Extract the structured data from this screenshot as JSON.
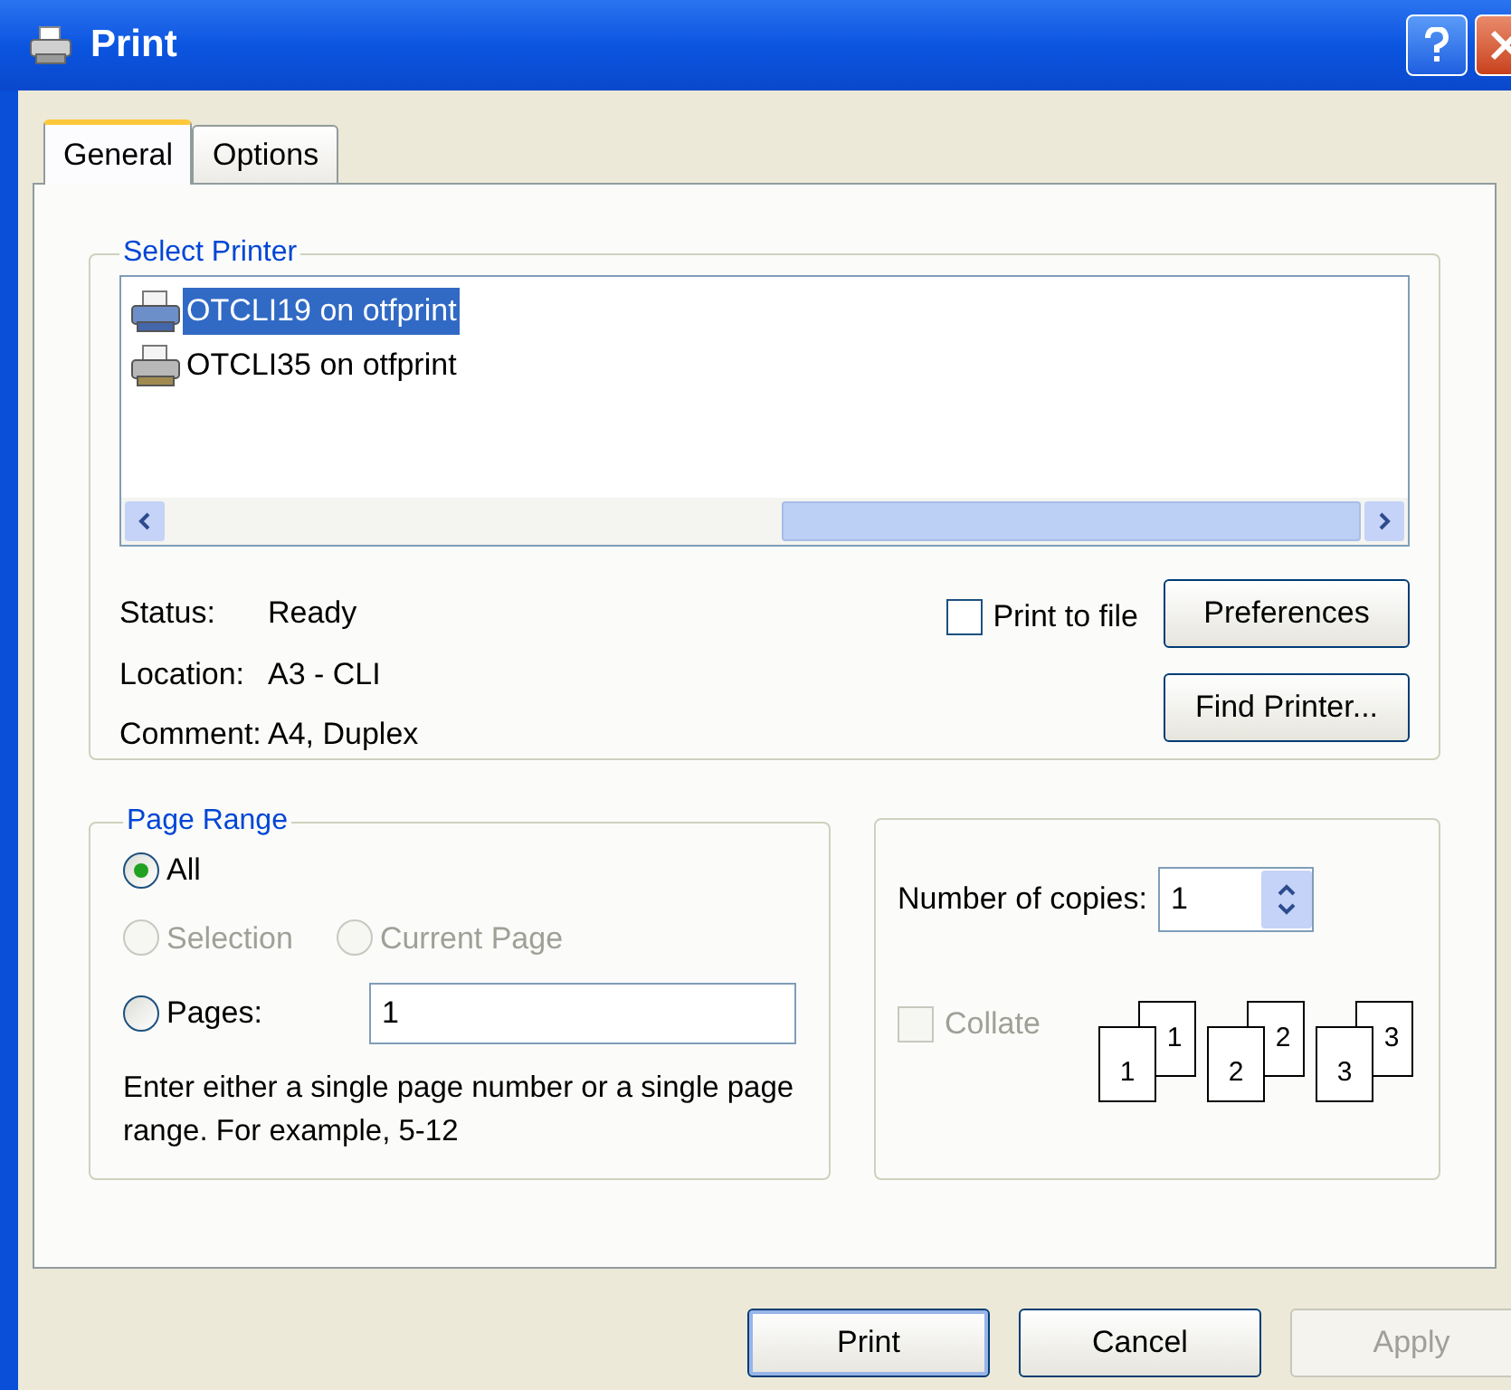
{
  "window": {
    "title": "Print"
  },
  "tabs": [
    {
      "label": "General",
      "selected": true
    },
    {
      "label": "Options",
      "selected": false
    }
  ],
  "select_printer": {
    "title": "Select Printer",
    "printers": [
      {
        "name": "OTCLI19 on otfprint",
        "selected": true
      },
      {
        "name": "OTCLI35 on otfprint",
        "selected": false
      }
    ],
    "info": [
      {
        "label": "Status:",
        "value": "Ready"
      },
      {
        "label": "Location:",
        "value": "A3 - CLI"
      },
      {
        "label": "Comment:",
        "value": "A4, Duplex"
      }
    ],
    "print_to_file": {
      "label": "Print to file",
      "checked": false
    },
    "buttons": [
      "Preferences",
      "Find Printer..."
    ]
  },
  "page_range": {
    "title": "Page Range",
    "options": [
      {
        "label": "All",
        "selected": true,
        "disabled": false
      },
      {
        "label": "Selection",
        "selected": false,
        "disabled": true
      },
      {
        "label": "Current Page",
        "selected": false,
        "disabled": true
      },
      {
        "label": "Pages:",
        "selected": false,
        "disabled": false
      }
    ],
    "pages_value": "1",
    "hint": "Enter either a single page number or a single page range.  For example, 5-12"
  },
  "copies": {
    "label": "Number of copies:",
    "value": "1",
    "collate": {
      "label": "Collate",
      "checked": false,
      "disabled": true
    },
    "collate_stacks": [
      {
        "back": "1",
        "front": "1"
      },
      {
        "back": "2",
        "front": "2"
      },
      {
        "back": "3",
        "front": "3"
      }
    ]
  },
  "buttons": [
    {
      "label": "Print",
      "disabled": false,
      "default": true
    },
    {
      "label": "Cancel",
      "disabled": false,
      "default": false
    },
    {
      "label": "Apply",
      "disabled": true,
      "default": false
    }
  ]
}
